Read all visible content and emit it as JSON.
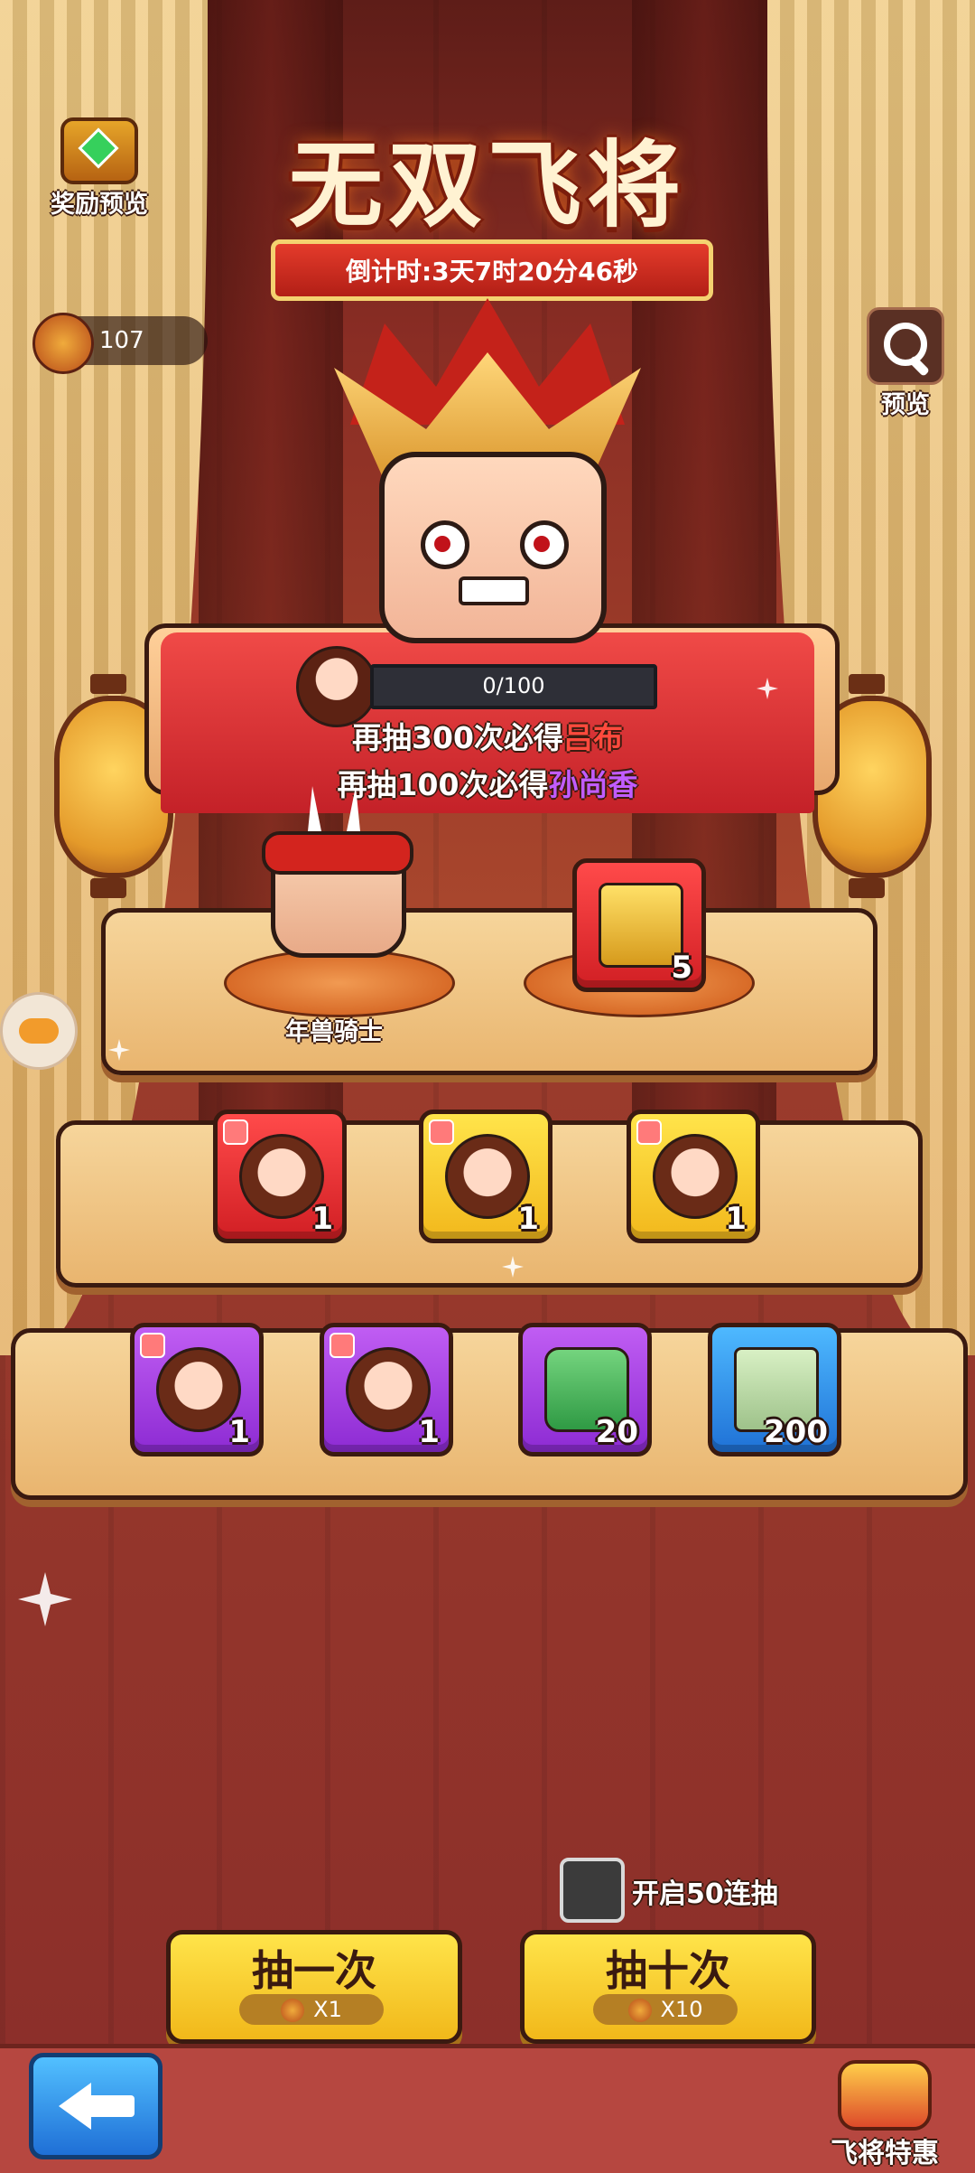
{
  "event": {
    "title": "无双飞将",
    "countdown": "倒计时:3天7时20分46秒"
  },
  "top_left": {
    "reward_preview_label": "奖励预览",
    "currency_value": "107"
  },
  "top_right": {
    "preview_label": "预览"
  },
  "progress": {
    "text": "0/100",
    "value": 0
  },
  "pity": {
    "line1_prefix": "再抽300次必得",
    "line1_name": "吕布",
    "line2_prefix": "再抽100次必得",
    "line2_name": "孙尚香"
  },
  "shelf1": {
    "knight_label": "年兽骑士",
    "gold_item_count": "5"
  },
  "shelf2": [
    {
      "count": "1",
      "rarity": "red"
    },
    {
      "count": "1",
      "rarity": "yellow"
    },
    {
      "count": "1",
      "rarity": "yellow"
    }
  ],
  "shelf3": [
    {
      "count": "1",
      "rarity": "purple"
    },
    {
      "count": "1",
      "rarity": "purple"
    },
    {
      "count": "20",
      "rarity": "purple"
    },
    {
      "count": "200",
      "rarity": "blue"
    }
  ],
  "options": {
    "fifty_label": "开启50连抽"
  },
  "draw": {
    "one_label": "抽一次",
    "one_cost": "X1",
    "ten_label": "抽十次",
    "ten_cost": "X10"
  },
  "bottom": {
    "special_label": "飞将特惠"
  },
  "colors": {
    "accent_red": "#ff4a3d",
    "accent_purple": "#c15cff",
    "button_yellow": "#ffe44a"
  }
}
